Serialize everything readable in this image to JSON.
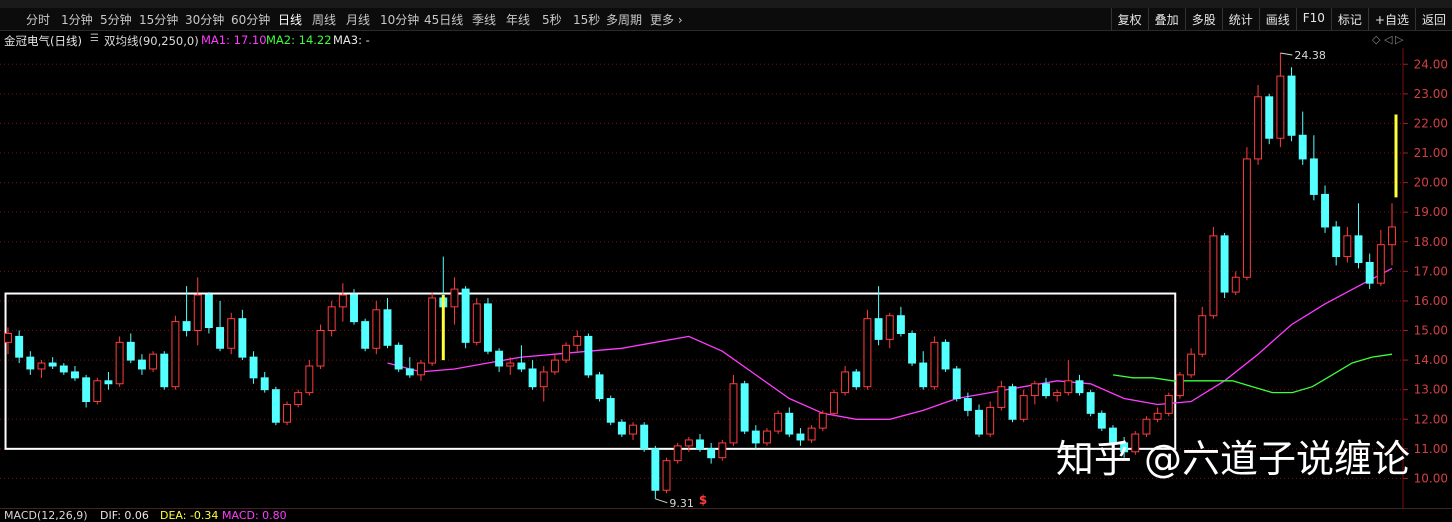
{
  "periods": [
    "分时",
    "1分钟",
    "5分钟",
    "15分钟",
    "30分钟",
    "60分钟",
    "日线",
    "周线",
    "月线",
    "10分钟",
    "45日线",
    "季线",
    "年线",
    "5秒",
    "15秒",
    "多周期",
    "更多 ›"
  ],
  "active_period": "日线",
  "tools": [
    "复权",
    "叠加",
    "多股",
    "统计",
    "画线",
    "F10",
    "标记",
    "+自选",
    "返回"
  ],
  "stock_title": "金冠电气(日线)",
  "indicator": "双均线(90,250,0)",
  "ma1_label": "MA1: 17.10",
  "ma2_label": "MA2: 14.22",
  "ma3_label": "MA3: -",
  "macd_title": "MACD(12,26,9)",
  "macd_dif": "DIF: 0.06",
  "macd_dea": "DEA: -0.34",
  "macd_macd": "MACD: 0.80",
  "watermark": "知乎 @六道子说缠论",
  "scroll_icons": [
    "◇",
    "◁",
    "▷"
  ],
  "colors": {
    "up": "#ff3c3c",
    "down": "#54ffff",
    "ma1": "#ff3cff",
    "ma2": "#3cff3c",
    "highlight": "#ffff3c",
    "box": "#ffffff",
    "grid": "#7a1010",
    "axis_text": "#d24040"
  },
  "chart_data": {
    "type": "candlestick",
    "y_ticks": [
      10.0,
      11.0,
      12.0,
      13.0,
      14.0,
      15.0,
      16.0,
      17.0,
      18.0,
      19.0,
      20.0,
      21.0,
      22.0,
      23.0,
      24.0
    ],
    "ylim": [
      9.0,
      24.55
    ],
    "grid": true,
    "annotations": [
      {
        "text": "24.38",
        "value": 24.38,
        "kind": "high"
      },
      {
        "text": "9.31",
        "value": 9.31,
        "kind": "low"
      }
    ],
    "marker": "$",
    "series": [
      {
        "name": "MA1",
        "type": "line",
        "values": [
          13.9,
          13.6,
          13.7,
          13.9,
          14.1,
          14.2,
          14.3,
          14.4,
          14.6,
          14.8,
          14.3,
          13.5,
          12.7,
          12.2,
          12.0,
          12.0,
          12.3,
          12.7,
          12.9,
          13.1,
          13.3,
          13.2,
          12.7,
          12.5,
          12.6,
          13.3,
          14.2,
          15.2,
          15.9,
          16.5,
          17.1
        ]
      },
      {
        "name": "MA2",
        "type": "line",
        "values": [
          13.5,
          13.4,
          13.4,
          13.3,
          13.3,
          13.3,
          13.3,
          13.1,
          12.9,
          12.9,
          13.1,
          13.5,
          13.9,
          14.1,
          14.2
        ]
      }
    ],
    "candles": [
      {
        "o": 14.6,
        "h": 15.1,
        "l": 14.2,
        "c": 14.9
      },
      {
        "o": 14.8,
        "h": 15.0,
        "l": 13.9,
        "c": 14.1
      },
      {
        "o": 14.1,
        "h": 14.3,
        "l": 13.5,
        "c": 13.7
      },
      {
        "o": 13.7,
        "h": 14.0,
        "l": 13.4,
        "c": 13.9
      },
      {
        "o": 13.9,
        "h": 14.1,
        "l": 13.7,
        "c": 13.8
      },
      {
        "o": 13.8,
        "h": 13.9,
        "l": 13.5,
        "c": 13.6
      },
      {
        "o": 13.6,
        "h": 13.8,
        "l": 13.3,
        "c": 13.4
      },
      {
        "o": 13.4,
        "h": 13.5,
        "l": 12.4,
        "c": 12.6
      },
      {
        "o": 12.6,
        "h": 13.4,
        "l": 12.5,
        "c": 13.3
      },
      {
        "o": 13.3,
        "h": 13.6,
        "l": 13.0,
        "c": 13.2
      },
      {
        "o": 13.2,
        "h": 14.8,
        "l": 13.1,
        "c": 14.6
      },
      {
        "o": 14.6,
        "h": 14.9,
        "l": 13.9,
        "c": 14.0
      },
      {
        "o": 14.0,
        "h": 14.2,
        "l": 13.5,
        "c": 13.7
      },
      {
        "o": 13.7,
        "h": 14.3,
        "l": 13.6,
        "c": 14.2
      },
      {
        "o": 14.2,
        "h": 14.3,
        "l": 13.0,
        "c": 13.1
      },
      {
        "o": 13.1,
        "h": 15.5,
        "l": 13.0,
        "c": 15.3
      },
      {
        "o": 15.3,
        "h": 16.5,
        "l": 14.8,
        "c": 15.0
      },
      {
        "o": 15.0,
        "h": 16.8,
        "l": 14.5,
        "c": 16.2
      },
      {
        "o": 16.2,
        "h": 16.3,
        "l": 14.9,
        "c": 15.1
      },
      {
        "o": 15.1,
        "h": 16.0,
        "l": 14.3,
        "c": 14.4
      },
      {
        "o": 14.4,
        "h": 15.6,
        "l": 14.2,
        "c": 15.4
      },
      {
        "o": 15.4,
        "h": 15.7,
        "l": 14.0,
        "c": 14.1
      },
      {
        "o": 14.1,
        "h": 14.3,
        "l": 13.2,
        "c": 13.4
      },
      {
        "o": 13.4,
        "h": 13.6,
        "l": 12.9,
        "c": 13.0
      },
      {
        "o": 13.0,
        "h": 13.1,
        "l": 11.8,
        "c": 11.9
      },
      {
        "o": 11.9,
        "h": 12.6,
        "l": 11.8,
        "c": 12.5
      },
      {
        "o": 12.5,
        "h": 13.0,
        "l": 12.4,
        "c": 12.9
      },
      {
        "o": 12.9,
        "h": 14.0,
        "l": 12.8,
        "c": 13.8
      },
      {
        "o": 13.8,
        "h": 15.2,
        "l": 13.7,
        "c": 15.0
      },
      {
        "o": 15.0,
        "h": 16.0,
        "l": 14.8,
        "c": 15.8
      },
      {
        "o": 15.8,
        "h": 16.6,
        "l": 15.3,
        "c": 16.2
      },
      {
        "o": 16.2,
        "h": 16.4,
        "l": 15.2,
        "c": 15.3
      },
      {
        "o": 15.3,
        "h": 15.4,
        "l": 14.3,
        "c": 14.4
      },
      {
        "o": 14.4,
        "h": 16.0,
        "l": 14.2,
        "c": 15.7
      },
      {
        "o": 15.7,
        "h": 16.1,
        "l": 14.4,
        "c": 14.5
      },
      {
        "o": 14.5,
        "h": 14.6,
        "l": 13.6,
        "c": 13.7
      },
      {
        "o": 13.7,
        "h": 14.1,
        "l": 13.4,
        "c": 13.5
      },
      {
        "o": 13.5,
        "h": 14.0,
        "l": 13.3,
        "c": 13.9
      },
      {
        "o": 13.9,
        "h": 16.3,
        "l": 13.8,
        "c": 16.1
      },
      {
        "o": 16.1,
        "h": 17.5,
        "l": 15.5,
        "c": 15.8
      },
      {
        "o": 15.8,
        "h": 16.8,
        "l": 15.2,
        "c": 16.4
      },
      {
        "o": 16.4,
        "h": 16.5,
        "l": 14.4,
        "c": 14.6
      },
      {
        "o": 14.6,
        "h": 16.1,
        "l": 14.5,
        "c": 15.9
      },
      {
        "o": 15.9,
        "h": 16.1,
        "l": 14.2,
        "c": 14.3
      },
      {
        "o": 14.3,
        "h": 14.4,
        "l": 13.6,
        "c": 13.8
      },
      {
        "o": 13.8,
        "h": 14.1,
        "l": 13.5,
        "c": 13.9
      },
      {
        "o": 13.9,
        "h": 14.5,
        "l": 13.6,
        "c": 13.7
      },
      {
        "o": 13.7,
        "h": 14.0,
        "l": 13.0,
        "c": 13.1
      },
      {
        "o": 13.1,
        "h": 13.8,
        "l": 12.6,
        "c": 13.6
      },
      {
        "o": 13.6,
        "h": 14.2,
        "l": 13.5,
        "c": 14.0
      },
      {
        "o": 14.0,
        "h": 14.6,
        "l": 13.9,
        "c": 14.5
      },
      {
        "o": 14.5,
        "h": 15.0,
        "l": 14.3,
        "c": 14.8
      },
      {
        "o": 14.8,
        "h": 14.9,
        "l": 13.4,
        "c": 13.5
      },
      {
        "o": 13.5,
        "h": 13.6,
        "l": 12.6,
        "c": 12.7
      },
      {
        "o": 12.7,
        "h": 12.8,
        "l": 11.8,
        "c": 11.9
      },
      {
        "o": 11.9,
        "h": 12.0,
        "l": 11.4,
        "c": 11.5
      },
      {
        "o": 11.5,
        "h": 11.9,
        "l": 11.3,
        "c": 11.8
      },
      {
        "o": 11.8,
        "h": 11.9,
        "l": 10.9,
        "c": 11.0
      },
      {
        "o": 11.0,
        "h": 11.1,
        "l": 9.31,
        "c": 9.6
      },
      {
        "o": 9.6,
        "h": 10.7,
        "l": 9.5,
        "c": 10.6
      },
      {
        "o": 10.6,
        "h": 11.2,
        "l": 10.5,
        "c": 11.1
      },
      {
        "o": 11.1,
        "h": 11.4,
        "l": 10.9,
        "c": 11.3
      },
      {
        "o": 11.3,
        "h": 11.5,
        "l": 10.9,
        "c": 11.0
      },
      {
        "o": 11.0,
        "h": 11.2,
        "l": 10.5,
        "c": 10.7
      },
      {
        "o": 10.7,
        "h": 11.3,
        "l": 10.6,
        "c": 11.2
      },
      {
        "o": 11.2,
        "h": 13.5,
        "l": 11.1,
        "c": 13.2
      },
      {
        "o": 13.2,
        "h": 13.3,
        "l": 11.5,
        "c": 11.6
      },
      {
        "o": 11.6,
        "h": 11.8,
        "l": 11.0,
        "c": 11.2
      },
      {
        "o": 11.2,
        "h": 11.7,
        "l": 11.1,
        "c": 11.6
      },
      {
        "o": 11.6,
        "h": 12.3,
        "l": 11.5,
        "c": 12.2
      },
      {
        "o": 12.2,
        "h": 12.4,
        "l": 11.4,
        "c": 11.5
      },
      {
        "o": 11.5,
        "h": 11.7,
        "l": 11.1,
        "c": 11.3
      },
      {
        "o": 11.3,
        "h": 11.8,
        "l": 11.2,
        "c": 11.7
      },
      {
        "o": 11.7,
        "h": 12.3,
        "l": 11.6,
        "c": 12.2
      },
      {
        "o": 12.2,
        "h": 13.0,
        "l": 12.1,
        "c": 12.9
      },
      {
        "o": 12.9,
        "h": 13.8,
        "l": 12.8,
        "c": 13.6
      },
      {
        "o": 13.6,
        "h": 13.7,
        "l": 13.0,
        "c": 13.1
      },
      {
        "o": 13.1,
        "h": 15.7,
        "l": 13.0,
        "c": 15.4
      },
      {
        "o": 15.4,
        "h": 16.5,
        "l": 14.5,
        "c": 14.7
      },
      {
        "o": 14.7,
        "h": 15.6,
        "l": 14.4,
        "c": 15.5
      },
      {
        "o": 15.5,
        "h": 15.8,
        "l": 14.8,
        "c": 14.9
      },
      {
        "o": 14.9,
        "h": 15.0,
        "l": 13.8,
        "c": 13.9
      },
      {
        "o": 13.9,
        "h": 14.3,
        "l": 13.0,
        "c": 13.1
      },
      {
        "o": 13.1,
        "h": 14.8,
        "l": 13.0,
        "c": 14.6
      },
      {
        "o": 14.6,
        "h": 14.7,
        "l": 13.6,
        "c": 13.7
      },
      {
        "o": 13.7,
        "h": 13.8,
        "l": 12.6,
        "c": 12.7
      },
      {
        "o": 12.7,
        "h": 12.9,
        "l": 12.1,
        "c": 12.3
      },
      {
        "o": 12.3,
        "h": 12.5,
        "l": 11.4,
        "c": 11.5
      },
      {
        "o": 11.5,
        "h": 12.6,
        "l": 11.4,
        "c": 12.4
      },
      {
        "o": 12.4,
        "h": 13.3,
        "l": 12.3,
        "c": 13.1
      },
      {
        "o": 13.1,
        "h": 13.2,
        "l": 11.9,
        "c": 12.0
      },
      {
        "o": 12.0,
        "h": 13.0,
        "l": 11.9,
        "c": 12.8
      },
      {
        "o": 12.8,
        "h": 13.3,
        "l": 12.5,
        "c": 13.2
      },
      {
        "o": 13.2,
        "h": 13.4,
        "l": 12.7,
        "c": 12.8
      },
      {
        "o": 12.8,
        "h": 13.0,
        "l": 12.6,
        "c": 12.9
      },
      {
        "o": 12.9,
        "h": 14.0,
        "l": 12.8,
        "c": 13.3
      },
      {
        "o": 13.3,
        "h": 13.5,
        "l": 12.8,
        "c": 12.9
      },
      {
        "o": 12.9,
        "h": 13.0,
        "l": 12.1,
        "c": 12.2
      },
      {
        "o": 12.2,
        "h": 12.3,
        "l": 11.6,
        "c": 11.7
      },
      {
        "o": 11.7,
        "h": 11.8,
        "l": 11.1,
        "c": 11.2
      },
      {
        "o": 11.2,
        "h": 11.4,
        "l": 10.7,
        "c": 10.9
      },
      {
        "o": 10.9,
        "h": 11.6,
        "l": 10.8,
        "c": 11.5
      },
      {
        "o": 11.5,
        "h": 12.1,
        "l": 11.4,
        "c": 12.0
      },
      {
        "o": 12.0,
        "h": 12.4,
        "l": 11.9,
        "c": 12.2
      },
      {
        "o": 12.2,
        "h": 12.9,
        "l": 12.1,
        "c": 12.8
      },
      {
        "o": 12.8,
        "h": 13.6,
        "l": 12.7,
        "c": 13.5
      },
      {
        "o": 13.5,
        "h": 14.4,
        "l": 13.4,
        "c": 14.2
      },
      {
        "o": 14.2,
        "h": 15.8,
        "l": 14.1,
        "c": 15.5
      },
      {
        "o": 15.5,
        "h": 18.5,
        "l": 15.4,
        "c": 18.2
      },
      {
        "o": 18.2,
        "h": 18.3,
        "l": 16.1,
        "c": 16.3
      },
      {
        "o": 16.3,
        "h": 17.0,
        "l": 16.2,
        "c": 16.8
      },
      {
        "o": 16.8,
        "h": 21.2,
        "l": 16.7,
        "c": 20.8
      },
      {
        "o": 20.8,
        "h": 23.3,
        "l": 20.6,
        "c": 22.9
      },
      {
        "o": 22.9,
        "h": 23.0,
        "l": 21.3,
        "c": 21.5
      },
      {
        "o": 21.5,
        "h": 24.38,
        "l": 21.2,
        "c": 23.6
      },
      {
        "o": 23.6,
        "h": 23.9,
        "l": 21.4,
        "c": 21.6
      },
      {
        "o": 21.6,
        "h": 22.4,
        "l": 20.6,
        "c": 20.8
      },
      {
        "o": 20.8,
        "h": 21.6,
        "l": 19.4,
        "c": 19.6
      },
      {
        "o": 19.6,
        "h": 19.9,
        "l": 18.3,
        "c": 18.5
      },
      {
        "o": 18.5,
        "h": 18.7,
        "l": 17.2,
        "c": 17.5
      },
      {
        "o": 17.5,
        "h": 18.5,
        "l": 17.3,
        "c": 18.2
      },
      {
        "o": 18.2,
        "h": 19.3,
        "l": 17.1,
        "c": 17.3
      },
      {
        "o": 17.3,
        "h": 17.6,
        "l": 16.4,
        "c": 16.6
      },
      {
        "o": 16.6,
        "h": 18.4,
        "l": 16.5,
        "c": 17.9
      },
      {
        "o": 17.9,
        "h": 19.3,
        "l": 17.2,
        "c": 18.5
      }
    ],
    "highlighted_candles": [
      {
        "index": 39,
        "value": 14.0,
        "to": 16.2
      },
      {
        "index": 125,
        "value": 19.5,
        "to": 22.3
      }
    ],
    "consolidation_box": {
      "start_index": 0,
      "end_index": 104,
      "low": 11.0,
      "high": 16.25
    }
  }
}
